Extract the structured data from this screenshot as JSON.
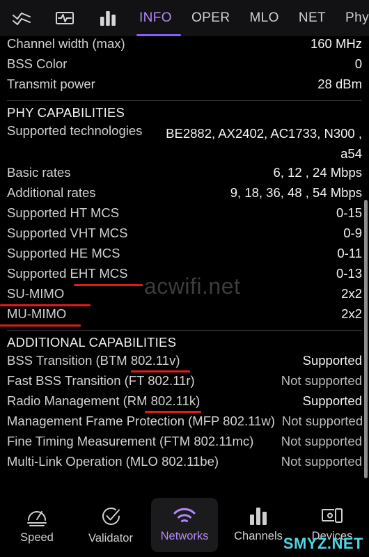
{
  "topbar": {
    "icons": [
      {
        "name": "wave-chart-icon"
      },
      {
        "name": "signal-monitor-icon"
      },
      {
        "name": "bar-chart-icon"
      }
    ],
    "tabs": [
      {
        "label": "INFO",
        "active": true
      },
      {
        "label": "OPER",
        "active": false
      },
      {
        "label": "MLO",
        "active": false
      },
      {
        "label": "NET",
        "active": false
      },
      {
        "label": "Phy",
        "active": false
      }
    ],
    "active_color": "#b389f5",
    "underline_color": "#8a5cf6"
  },
  "content": {
    "top_rows": [
      {
        "label": "Channel width (max)",
        "value": "160 MHz"
      },
      {
        "label": "BSS Color",
        "value": "0"
      },
      {
        "label": "Transmit power",
        "value": "28 dBm"
      }
    ],
    "phy_section": {
      "title": "PHY CAPABILITIES",
      "rows": [
        {
          "label": "Supported technologies",
          "value": "BE2882, AX2402, AC1733, N300 , a54",
          "multiline": true
        },
        {
          "label": "Basic rates",
          "value": "6, 12 , 24 Mbps"
        },
        {
          "label": "Additional rates",
          "value": "9, 18, 36, 48 , 54 Mbps"
        },
        {
          "label": "Supported HT MCS",
          "value": "0-15"
        },
        {
          "label": "Supported VHT MCS",
          "value": "0-9"
        },
        {
          "label": "Supported HE MCS",
          "value": "0-11"
        },
        {
          "label": "Supported EHT MCS",
          "value": "0-13",
          "underline": true
        },
        {
          "label": "SU-MIMO",
          "value": "2x2",
          "underline": true
        },
        {
          "label": "MU-MIMO",
          "value": "2x2",
          "underline": true
        }
      ]
    },
    "additional_section": {
      "title": "ADDITIONAL CAPABILITIES",
      "rows": [
        {
          "label": "BSS Transition (BTM 802.11v)",
          "value": "Supported",
          "supported": true,
          "underline": true
        },
        {
          "label": "Fast BSS Transition (FT 802.11r)",
          "value": "Not supported",
          "supported": false
        },
        {
          "label": "Radio Management (RM 802.11k)",
          "value": "Supported",
          "supported": true,
          "underline": true
        },
        {
          "label": "Management Frame Protection (MFP 802.11w)",
          "value": "Not supported",
          "supported": false
        },
        {
          "label": "Fine Timing Measurement (FTM 802.11mc)",
          "value": "Not supported",
          "supported": false
        },
        {
          "label": "Multi-Link Operation (MLO 802.11be)",
          "value": "Not supported",
          "supported": false
        }
      ]
    },
    "annotation_color": "#e01b1b"
  },
  "watermarks": {
    "primary": "acwifi.net",
    "secondary": "SMYZ.NET",
    "secondary_color": "#4fd6e4"
  },
  "bottomnav": {
    "items": [
      {
        "label": "Speed",
        "icon": "speedometer-icon",
        "active": false
      },
      {
        "label": "Validator",
        "icon": "check-circle-icon",
        "active": false
      },
      {
        "label": "Networks",
        "icon": "wifi-icon",
        "active": true
      },
      {
        "label": "Channels",
        "icon": "bar-chart-icon",
        "active": false
      },
      {
        "label": "Devices",
        "icon": "devices-icon",
        "active": false
      }
    ]
  }
}
